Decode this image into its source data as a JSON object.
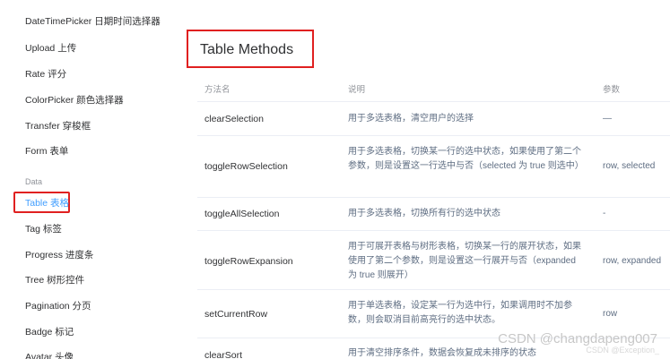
{
  "sidebar": {
    "items_top": [
      {
        "label": "DateTimePicker 日期时间选择器"
      },
      {
        "label": "Upload 上传"
      },
      {
        "label": "Rate 评分"
      },
      {
        "label": "ColorPicker 颜色选择器"
      },
      {
        "label": "Transfer 穿梭框"
      },
      {
        "label": "Form 表单"
      }
    ],
    "group_label": "Data",
    "items_data": [
      {
        "label": "Table 表格",
        "active": true
      },
      {
        "label": "Tag 标签"
      },
      {
        "label": "Progress 进度条"
      },
      {
        "label": "Tree 树形控件"
      },
      {
        "label": "Pagination 分页"
      },
      {
        "label": "Badge 标记"
      },
      {
        "label": "Avatar 头像"
      }
    ]
  },
  "main": {
    "title": "Table Methods",
    "columns": [
      "方法名",
      "说明",
      "参数"
    ],
    "rows": [
      {
        "name": "clearSelection",
        "desc": "用于多选表格，清空用户的选择",
        "param": "—"
      },
      {
        "name": "toggleRowSelection",
        "desc": "用于多选表格，切换某一行的选中状态，如果使用了第二个参数，则是设置这一行选中与否（selected 为 true 则选中）",
        "param": "row, selected"
      },
      {
        "name": "toggleAllSelection",
        "desc": "用于多选表格，切换所有行的选中状态",
        "param": "-"
      },
      {
        "name": "toggleRowExpansion",
        "desc": "用于可展开表格与树形表格，切换某一行的展开状态，如果使用了第二个参数，则是设置这一行展开与否（expanded 为 true 则展开）",
        "param": "row, expanded"
      },
      {
        "name": "setCurrentRow",
        "desc": "用于单选表格，设定某一行为选中行，如果调用时不加参数，则会取消目前高亮行的选中状态。",
        "param": "row"
      },
      {
        "name": "clearSort",
        "desc": "用于清空排序条件，数据会恢复成未排序的状态",
        "param": ""
      }
    ]
  },
  "watermark": {
    "text": "CSDN @changdapeng007",
    "sub": "CSDN @Exception_"
  },
  "colors": {
    "accent": "#409eff",
    "highlight_border": "#e02020"
  }
}
